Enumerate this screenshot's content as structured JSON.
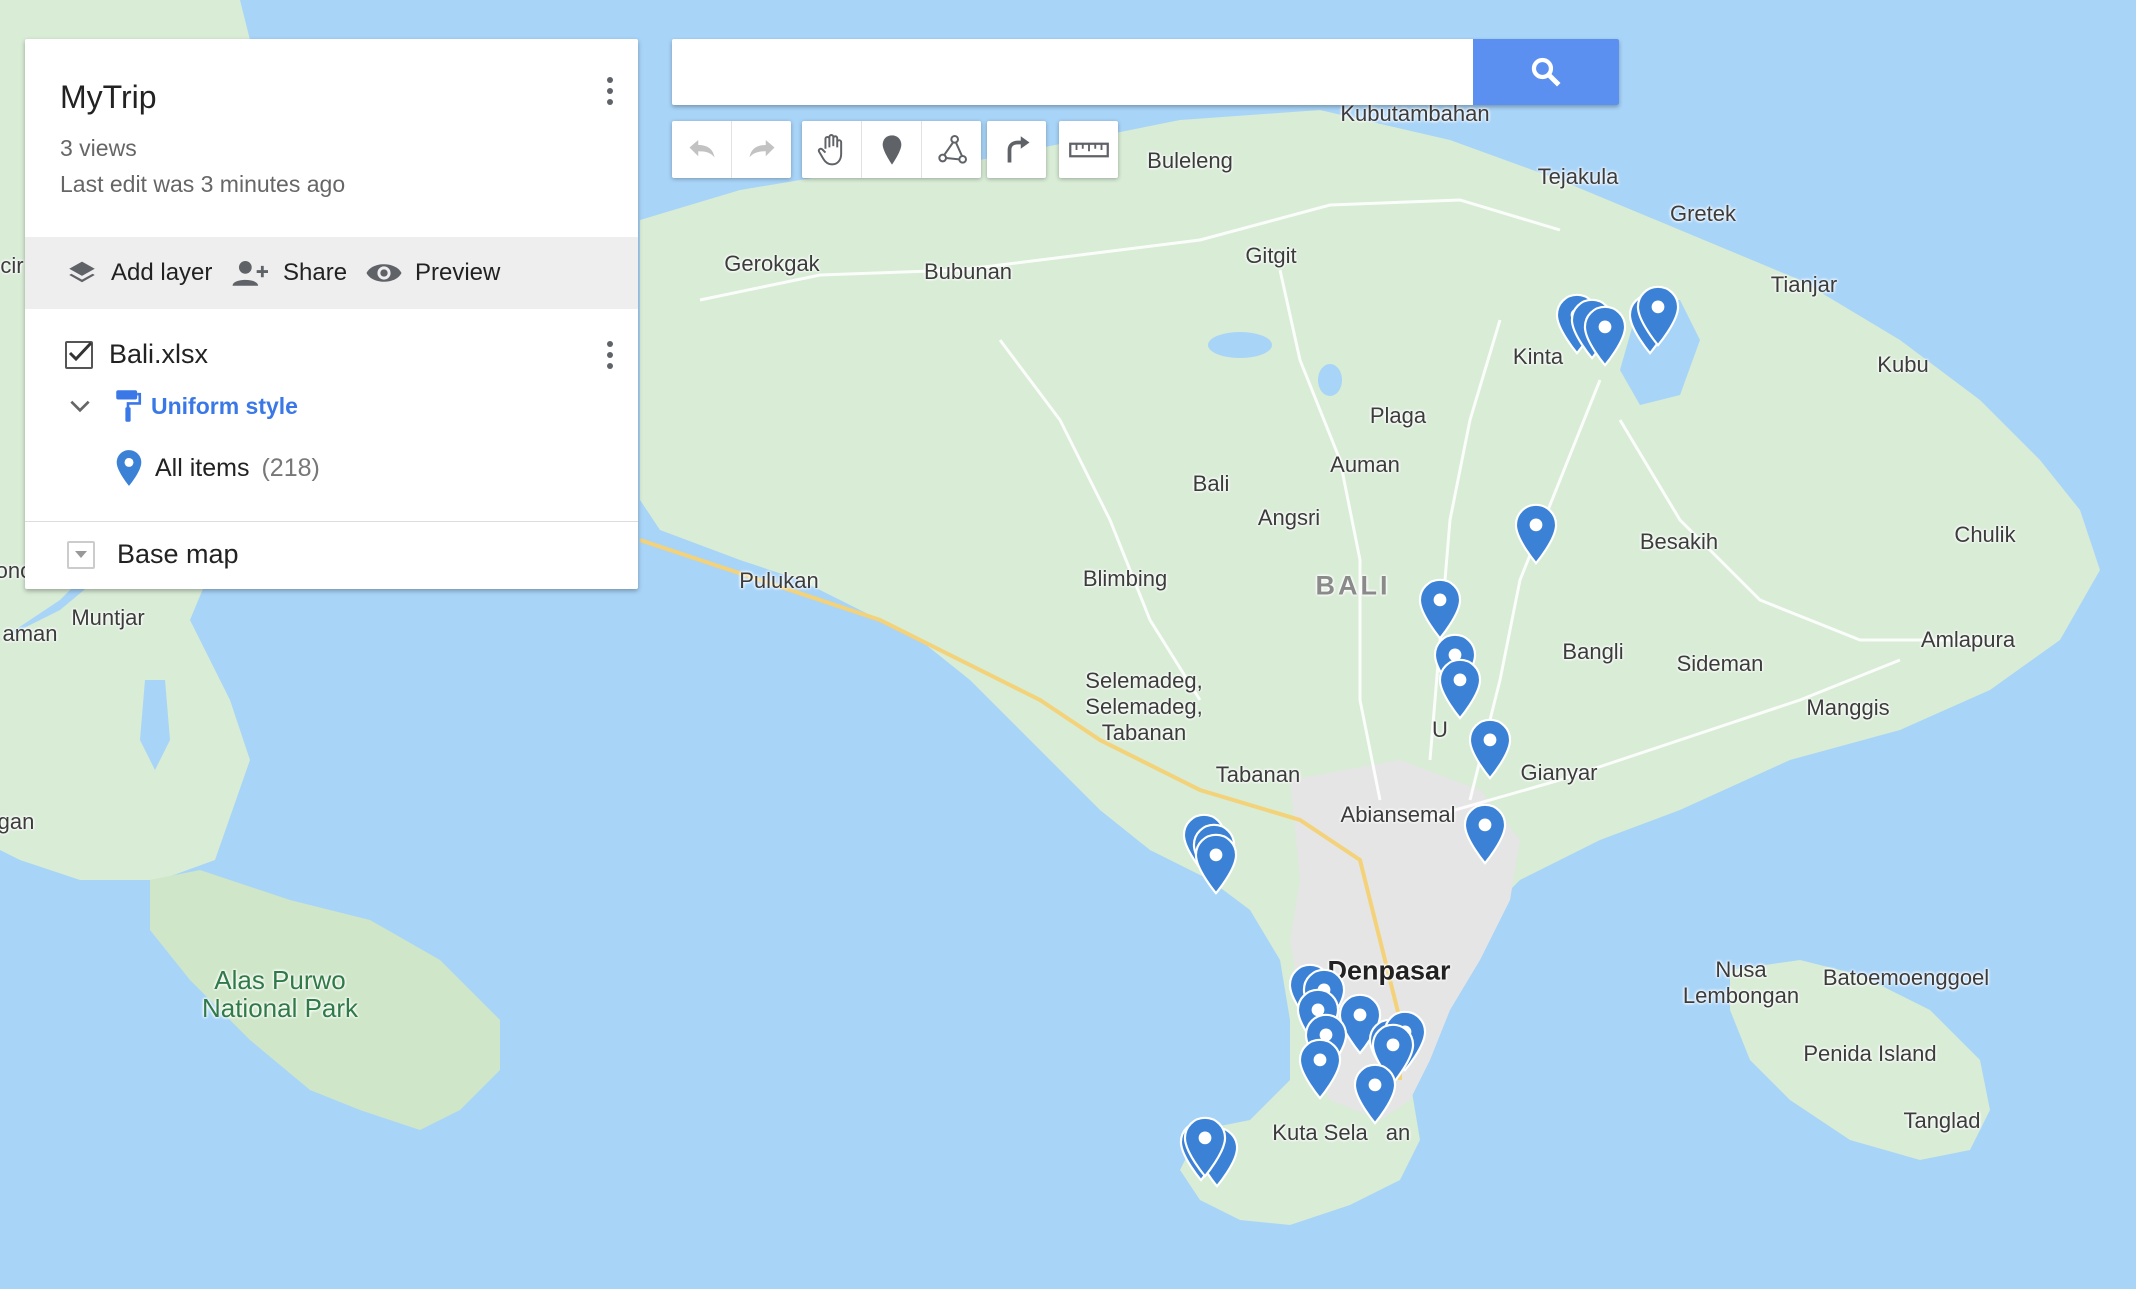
{
  "map": {
    "title": "MyTrip",
    "views": "3 views",
    "last_edit": "Last edit was 3 minutes ago",
    "actions": {
      "add_layer": "Add layer",
      "share": "Share",
      "preview": "Preview"
    },
    "layer": {
      "name": "Bali.xlsx",
      "checked": true,
      "style_label": "Uniform style",
      "items_label": "All items",
      "items_count": "(218)"
    },
    "base_map_label": "Base map"
  },
  "search": {
    "value": "",
    "placeholder": ""
  },
  "toolbar": {
    "history": [
      "undo-icon",
      "redo-icon"
    ],
    "tools": [
      "hand-icon",
      "marker-icon",
      "line-icon"
    ],
    "directions": "directions-icon",
    "measure": "ruler-icon"
  },
  "colors": {
    "water": "#a8d4f8",
    "land": "#d8ecd6",
    "urban": "#e3e3e3",
    "pin": "#3b82d6",
    "accent": "#3b78e7",
    "search_button": "#5b8ff0"
  },
  "places": {
    "kubutambahan": "Kubutambahan",
    "buleleng": "Buleleng",
    "tejakula": "Tejakula",
    "gretek": "Gretek",
    "gerokgak": "Gerokgak",
    "bubunan": "Bubunan",
    "gitgit": "Gitgit",
    "tianjar": "Tianjar",
    "kintamani": "Kinta",
    "kubu": "Kubu",
    "plaga": "Plaga",
    "auman": "Auman",
    "bali_town": "Bali",
    "angsri": "Angsri",
    "besakih": "Besakih",
    "chulik": "Chulik",
    "pulukan": "Pulukan",
    "blimbing": "Blimbing",
    "bali_region": "BALI",
    "muntjar": "Muntjar",
    "bangli": "Bangli",
    "sideman": "Sideman",
    "amlapura": "Amlapura",
    "selemadeg": "Selemadeg,\nSelemadeg,\nTabanan",
    "manggis": "Manggis",
    "ubud": "U",
    "gianyar": "Gianyar",
    "tabanan": "Tabanan",
    "abiansemal": "Abiansemal",
    "alas_purwo": "Alas Purwo\nNational Park",
    "denpasar": "Denpasar",
    "nusa_lembongan": "Nusa\nLembongan",
    "batoemoenggoel": "Batoemoenggoel",
    "penida": "Penida Island",
    "tanglad": "Tanglad",
    "kuta_selatan": "Kuta Sela",
    "kuta_selatan_end": "an",
    "edge_cir": "cir",
    "edge_ono": "ono",
    "edge_aman": "aman",
    "edge_gan": "gan"
  }
}
